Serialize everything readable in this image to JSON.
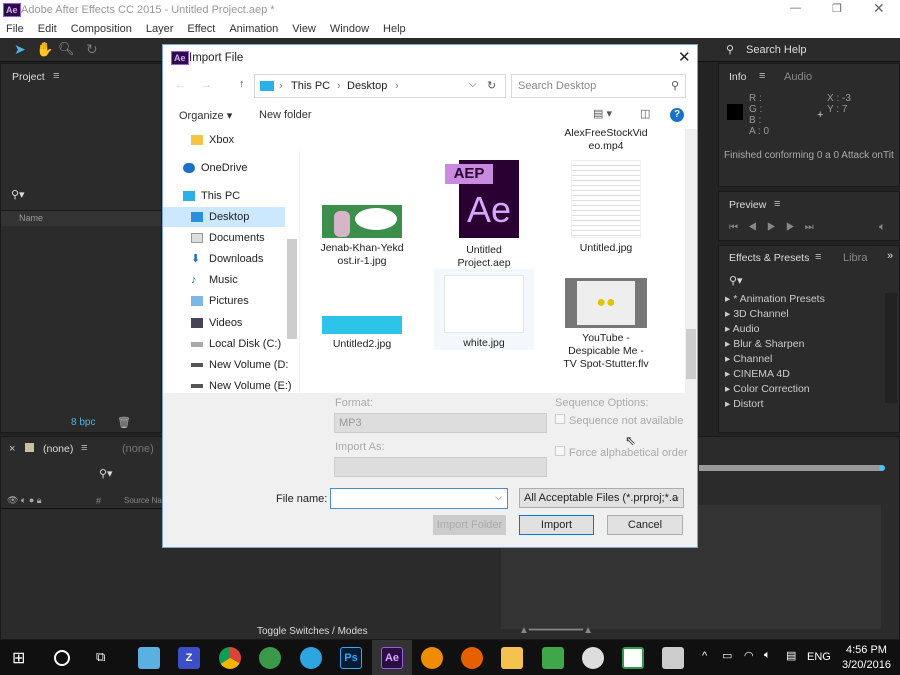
{
  "app": {
    "title": "Adobe After Effects CC 2015 - Untitled Project.aep *",
    "logo": "Ae",
    "menu": [
      "File",
      "Edit",
      "Composition",
      "Layer",
      "Effect",
      "Animation",
      "View",
      "Window",
      "Help"
    ],
    "search_help": "Search Help"
  },
  "project_panel": {
    "title": "Project",
    "name_col": "Name",
    "bpc": "8 bpc"
  },
  "info_panel": {
    "tab": "Info",
    "tab2": "Audio",
    "r": "R :",
    "g": "G :",
    "b": "B :",
    "a": "A : 0",
    "x": "X : -3",
    "y": "Y : 7",
    "status": "Finished conforming 0 a 0 Attack onTit"
  },
  "preview_panel": {
    "title": "Preview"
  },
  "effects_panel": {
    "tab": "Effects & Presets",
    "tab2": "Libra",
    "items": [
      "* Animation Presets",
      "3D Channel",
      "Audio",
      "Blur & Sharpen",
      "Channel",
      "CINEMA 4D",
      "Color Correction",
      "Distort"
    ]
  },
  "timeline": {
    "comp": "(none)",
    "comp2": "(none)",
    "source_name": "Source Name",
    "hash": "#",
    "toggle": "Toggle Switches / Modes"
  },
  "dialog": {
    "title": "Import File",
    "breadcrumb": [
      "This PC",
      "Desktop"
    ],
    "search_placeholder": "Search Desktop",
    "organize": "Organize",
    "new_folder": "New folder",
    "nav": [
      "Xbox",
      "OneDrive",
      "This PC",
      "Desktop",
      "Documents",
      "Downloads",
      "Music",
      "Pictures",
      "Videos",
      "Local Disk (C:)",
      "New Volume (D:",
      "New Volume (E:)"
    ],
    "selected_nav": "Desktop",
    "files": [
      {
        "name": "AlexFreeStockVideo.mp4"
      },
      {
        "name": "Jenab-Khan-Yekdost.ir-1.jpg"
      },
      {
        "name": "Untitled Project.aep"
      },
      {
        "name": "Untitled.jpg"
      },
      {
        "name": "Untitled2.jpg"
      },
      {
        "name": "white.jpg"
      },
      {
        "name": "YouTube - Despicable Me - TV Spot-Stutter.flv"
      }
    ],
    "format_label": "Format:",
    "format_value": "MP3",
    "import_as_label": "Import As:",
    "sequence_options": "Sequence Options:",
    "sequence_checkbox": "Sequence not available",
    "alpha_checkbox": "Force alphabetical order",
    "file_name_label": "File name:",
    "file_name_value": "",
    "file_type": "All Acceptable Files (*.prproj;*.a",
    "import_folder": "Import Folder",
    "import": "Import",
    "cancel": "Cancel"
  },
  "taskbar": {
    "lang": "ENG",
    "time": "4:56 PM",
    "date": "3/20/2016"
  }
}
